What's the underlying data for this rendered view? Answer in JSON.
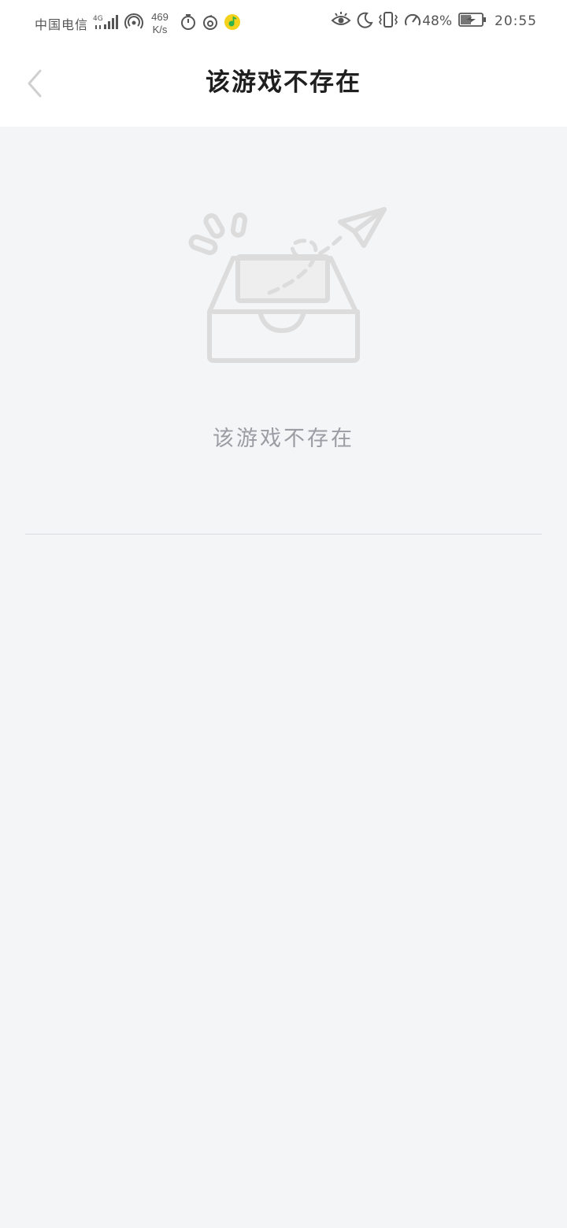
{
  "status_bar": {
    "carrier": "中国电信",
    "network_type": "4G",
    "net_speed_value": "469",
    "net_speed_unit": "K/s",
    "battery_percent": "48%",
    "time": "20:55",
    "icons": [
      "signal-icon",
      "hotspot-icon",
      "timer-icon",
      "netease-music-icon",
      "qq-music-icon",
      "eye-comfort-icon",
      "moon-icon",
      "vibrate-icon",
      "speed-gauge-icon",
      "battery-charging-icon"
    ]
  },
  "header": {
    "back_icon": "chevron-left-icon",
    "title": "该游戏不存在"
  },
  "empty_state": {
    "illustration": "empty-inbox-paper-plane-illustration",
    "message": "该游戏不存在"
  },
  "colors": {
    "background": "#f4f5f7",
    "header_background": "#ffffff",
    "title_text": "#1f1f1f",
    "message_text": "#9a9da3",
    "illustration_stroke": "#dcdcdc"
  }
}
